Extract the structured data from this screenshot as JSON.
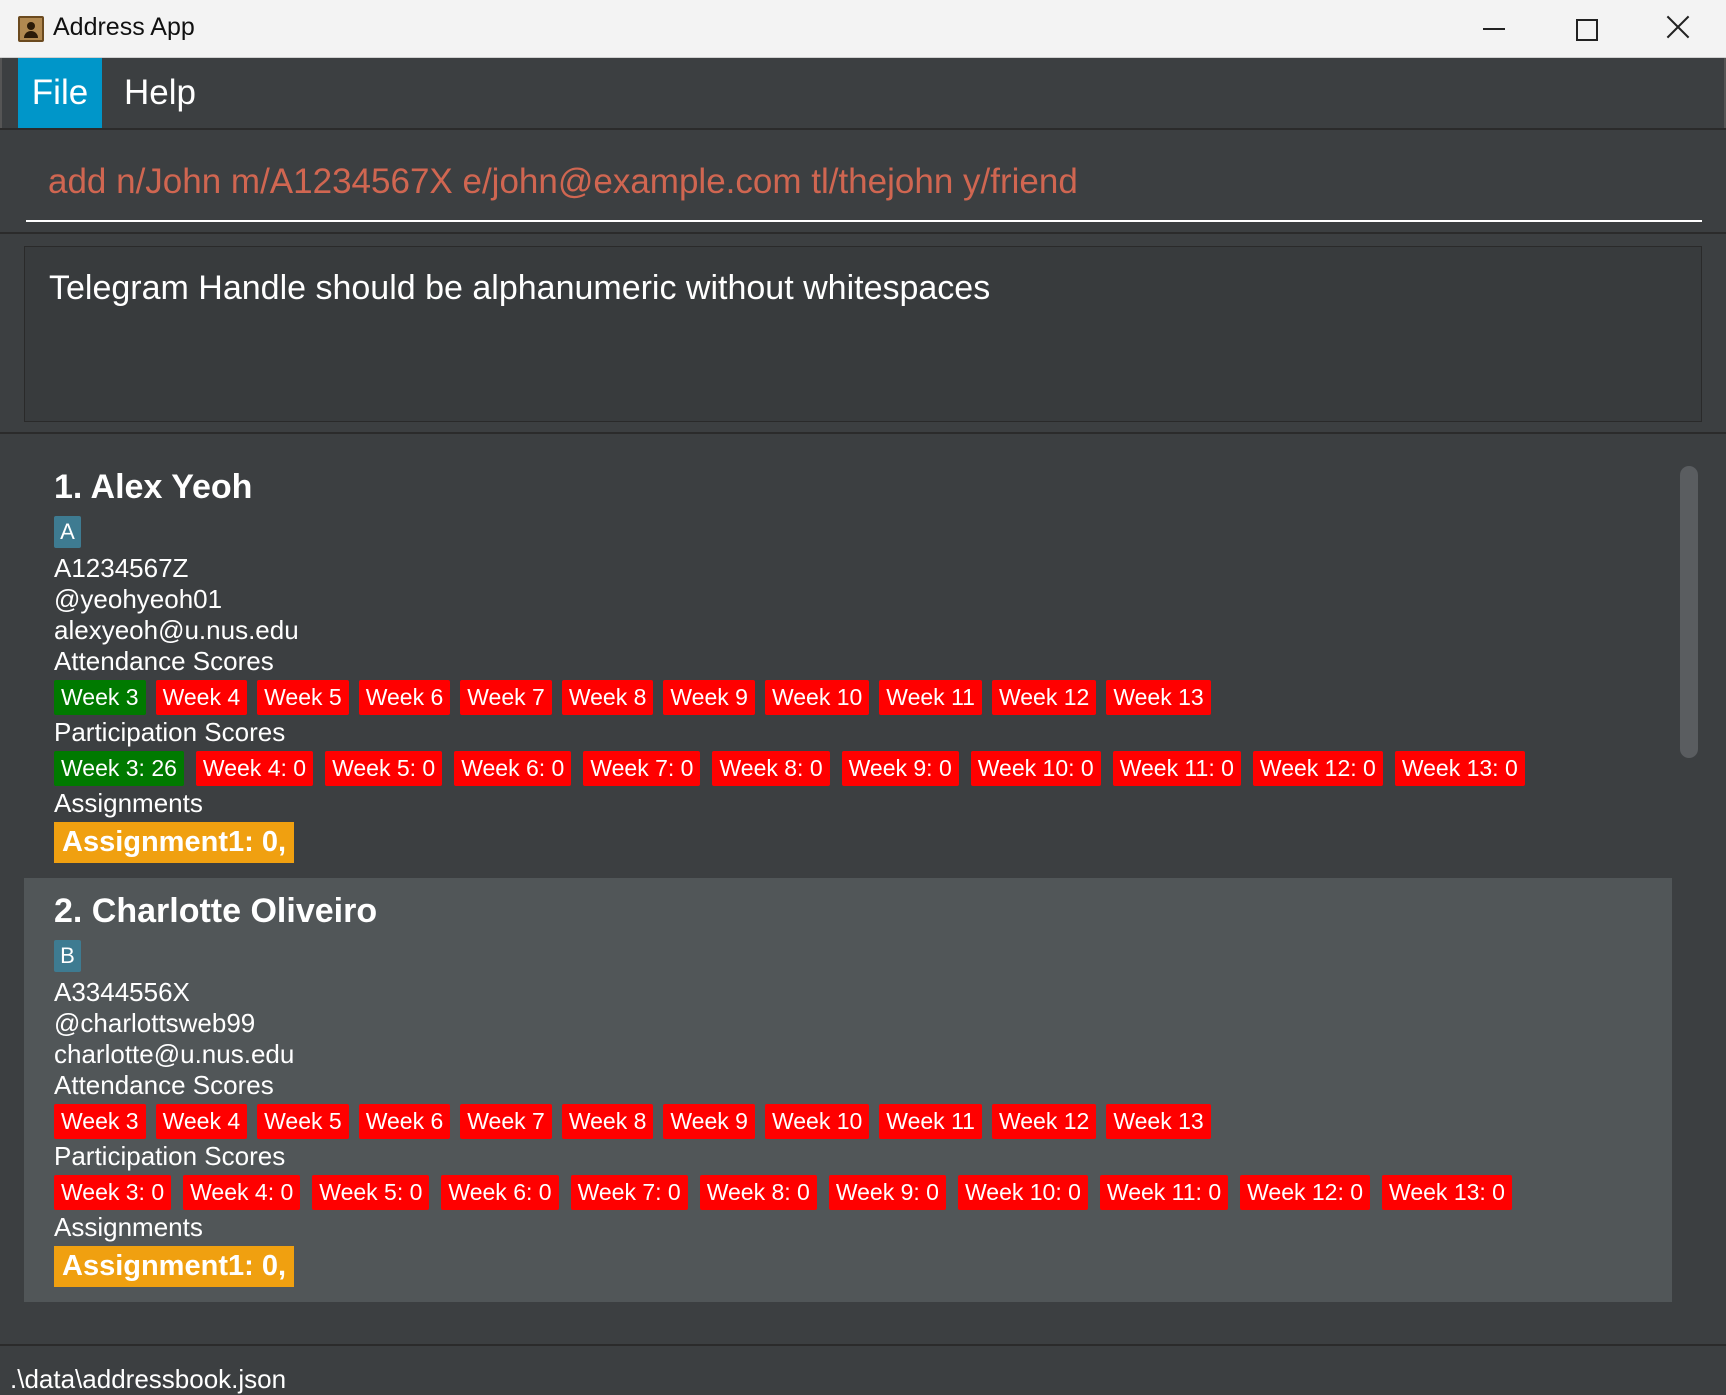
{
  "window": {
    "title": "Address App",
    "minimize_icon": "minimize-icon",
    "maximize_icon": "maximize-icon",
    "close_icon": "close-icon"
  },
  "menu": {
    "file_label": "File",
    "help_label": "Help",
    "active_color": "#0096c9"
  },
  "command": {
    "value": "add n/John m/A1234567X e/john@example.com tl/thejohn y/friend",
    "text_color": "#d06651"
  },
  "result": {
    "message": "Telegram Handle should be alphanumeric without whitespaces"
  },
  "persons": [
    {
      "title": "1.  Alex Yeoh",
      "group": "A",
      "matric": "A1234567Z",
      "telegram": "@yeohyeoh01",
      "email": "alexyeoh@u.nus.edu",
      "attendance_label": "Attendance Scores",
      "attendance": [
        {
          "label": "Week 3",
          "status": "present"
        },
        {
          "label": "Week 4",
          "status": "absent"
        },
        {
          "label": "Week 5",
          "status": "absent"
        },
        {
          "label": "Week 6",
          "status": "absent"
        },
        {
          "label": "Week 7",
          "status": "absent"
        },
        {
          "label": "Week 8",
          "status": "absent"
        },
        {
          "label": "Week 9",
          "status": "absent"
        },
        {
          "label": "Week 10",
          "status": "absent"
        },
        {
          "label": "Week 11",
          "status": "absent"
        },
        {
          "label": "Week 12",
          "status": "absent"
        },
        {
          "label": "Week 13",
          "status": "absent"
        }
      ],
      "participation_label": "Participation Scores",
      "participation": [
        {
          "label": "Week 3: 26",
          "status": "present"
        },
        {
          "label": "Week 4: 0",
          "status": "absent"
        },
        {
          "label": "Week 5: 0",
          "status": "absent"
        },
        {
          "label": "Week 6: 0",
          "status": "absent"
        },
        {
          "label": "Week 7: 0",
          "status": "absent"
        },
        {
          "label": "Week 8: 0",
          "status": "absent"
        },
        {
          "label": "Week 9: 0",
          "status": "absent"
        },
        {
          "label": "Week 10: 0",
          "status": "absent"
        },
        {
          "label": "Week 11: 0",
          "status": "absent"
        },
        {
          "label": "Week 12: 0",
          "status": "absent"
        },
        {
          "label": "Week 13: 0",
          "status": "absent"
        }
      ],
      "assignments_label": "Assignments",
      "assignment": "Assignment1: 0,"
    },
    {
      "title": "2.  Charlotte Oliveiro",
      "group": "B",
      "matric": "A3344556X",
      "telegram": "@charlottsweb99",
      "email": "charlotte@u.nus.edu",
      "attendance_label": "Attendance Scores",
      "attendance": [
        {
          "label": "Week 3",
          "status": "absent"
        },
        {
          "label": "Week 4",
          "status": "absent"
        },
        {
          "label": "Week 5",
          "status": "absent"
        },
        {
          "label": "Week 6",
          "status": "absent"
        },
        {
          "label": "Week 7",
          "status": "absent"
        },
        {
          "label": "Week 8",
          "status": "absent"
        },
        {
          "label": "Week 9",
          "status": "absent"
        },
        {
          "label": "Week 10",
          "status": "absent"
        },
        {
          "label": "Week 11",
          "status": "absent"
        },
        {
          "label": "Week 12",
          "status": "absent"
        },
        {
          "label": "Week 13",
          "status": "absent"
        }
      ],
      "participation_label": "Participation Scores",
      "participation": [
        {
          "label": "Week 3: 0",
          "status": "absent"
        },
        {
          "label": "Week 4: 0",
          "status": "absent"
        },
        {
          "label": "Week 5: 0",
          "status": "absent"
        },
        {
          "label": "Week 6: 0",
          "status": "absent"
        },
        {
          "label": "Week 7: 0",
          "status": "absent"
        },
        {
          "label": "Week 8: 0",
          "status": "absent"
        },
        {
          "label": "Week 9: 0",
          "status": "absent"
        },
        {
          "label": "Week 10: 0",
          "status": "absent"
        },
        {
          "label": "Week 11: 0",
          "status": "absent"
        },
        {
          "label": "Week 12: 0",
          "status": "absent"
        },
        {
          "label": "Week 13: 0",
          "status": "absent"
        }
      ],
      "assignments_label": "Assignments",
      "assignment": "Assignment1: 0,"
    }
  ],
  "colors": {
    "present": "#007a00",
    "absent": "#ff0000",
    "assignment": "#f0a010",
    "group_badge": "#3e7b91"
  },
  "status": {
    "file_path": ".\\data\\addressbook.json"
  }
}
